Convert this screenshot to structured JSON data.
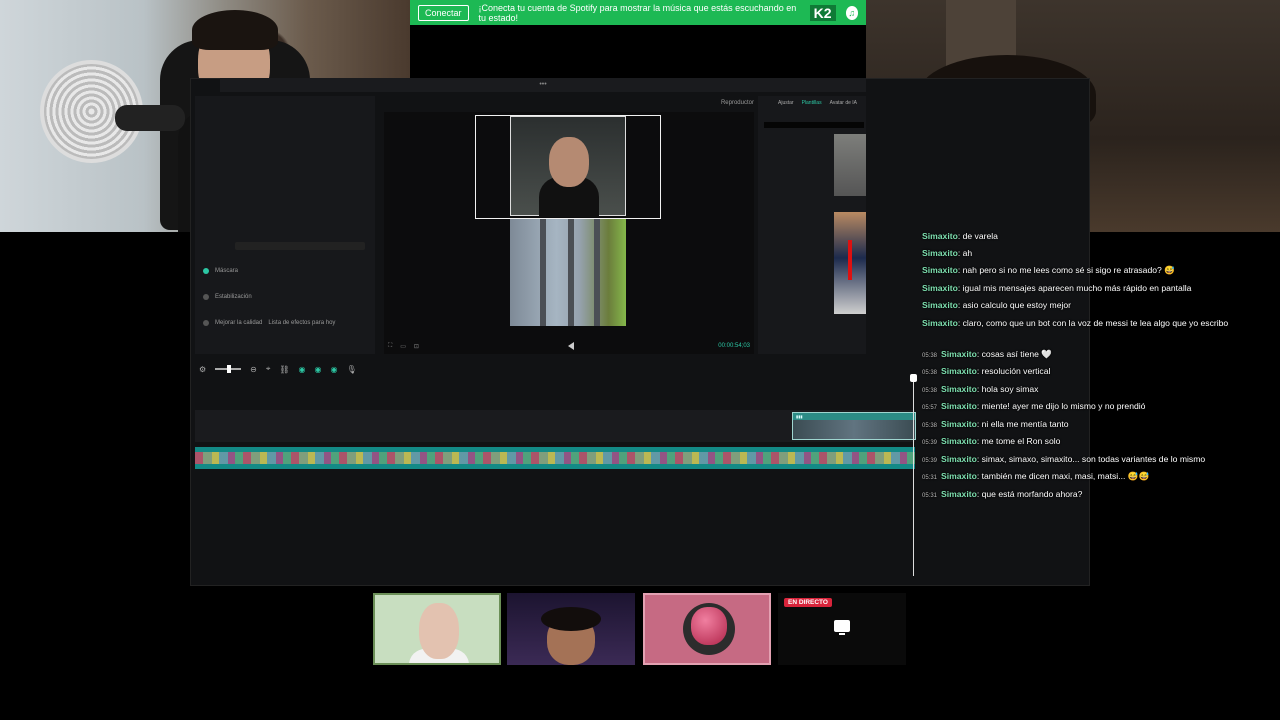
{
  "spotify": {
    "connect_label": "Conectar",
    "message": "¡Conecta tu cuenta de Spotify para mostrar la música que estás escuchando en tu estado!",
    "logo": "K2"
  },
  "editor": {
    "preview_label": "Reproductor",
    "preview_time": "00:00:54;03",
    "left_panel": {
      "items": [
        "Máscara",
        "Estabilización",
        "Mejorar la calidad",
        "Lista de efectos para hoy"
      ]
    },
    "right_panel_tabs": [
      "Ajustar",
      "Plantillas",
      "Avatar de IA"
    ]
  },
  "chat": {
    "messages": [
      {
        "time": "",
        "user": "Simaxito",
        "text": ": de varela"
      },
      {
        "time": "",
        "user": "Simaxito",
        "text": ": ah"
      },
      {
        "time": "",
        "user": "Simaxito",
        "text": ": nah pero si no me lees como sé si sigo re atrasado? 😅"
      },
      {
        "time": "",
        "user": "Simaxito",
        "text": ": igual mis mensajes aparecen mucho más rápido en pantalla"
      },
      {
        "time": "",
        "user": "Simaxito",
        "text": ": asio calculo que estoy mejor"
      },
      {
        "time": "",
        "user": "Simaxito",
        "text": ": claro, como que un bot con la voz de messi te lea algo que yo escribo"
      },
      {
        "time": "05:38",
        "user": "Simaxito",
        "text": ": cosas así tiene 🤍"
      },
      {
        "time": "05:38",
        "user": "Simaxito",
        "text": ": resolución vertical"
      },
      {
        "time": "05:38",
        "user": "Simaxito",
        "text": ": hola soy simax"
      },
      {
        "time": "05:57",
        "user": "Simaxito",
        "text": ": miente! ayer me dijo lo mismo y no prendió"
      },
      {
        "time": "05:38",
        "user": "Simaxito",
        "text": ": ni ella me mentía tanto"
      },
      {
        "time": "05:39",
        "user": "Simaxito",
        "text": ": me tome el Ron solo"
      },
      {
        "time": "05:39",
        "user": "Simaxito",
        "text": ": simax, simaxo, simaxito... son todas variantes de lo mismo"
      },
      {
        "time": "05:31",
        "user": "Simaxito",
        "text": ": también me dicen maxi, masi, matsi... 😅😅"
      },
      {
        "time": "05:31",
        "user": "Simaxito",
        "text": ": que está morfando ahora?"
      }
    ]
  },
  "tiles": {
    "live_badge": "EN DIRECTO"
  },
  "colors": {
    "accent": "#2cc7a4",
    "spotify": "#1db954",
    "live": "#d8243b",
    "chat_user": "#7ee0b0"
  }
}
